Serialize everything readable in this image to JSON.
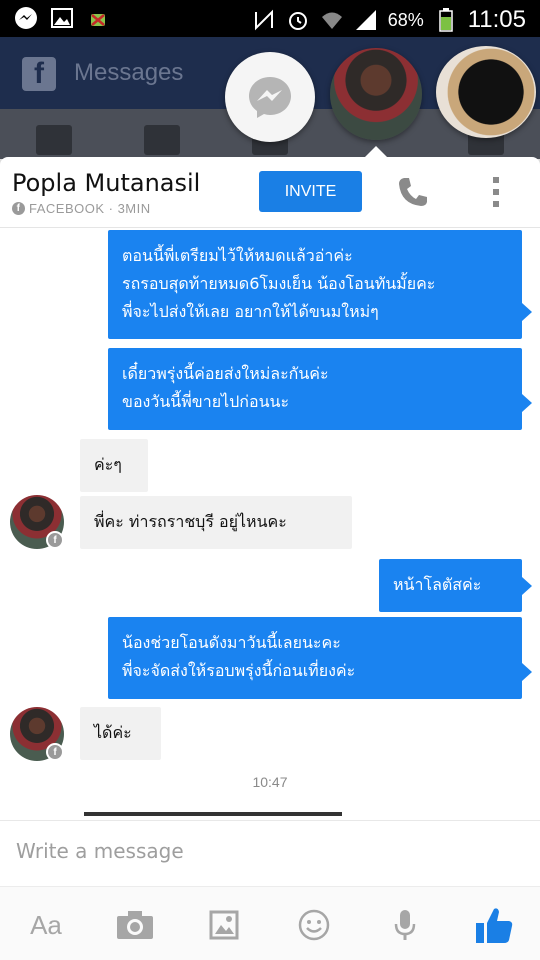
{
  "status_bar": {
    "battery": "68%",
    "time": "11:05",
    "icons": [
      "messenger-icon",
      "image-icon",
      "android-debug-icon",
      "nfc-icon",
      "alarm-icon",
      "wifi-icon",
      "signal-icon",
      "battery-icon"
    ]
  },
  "background_app": {
    "title": "Messages",
    "logo": "f"
  },
  "chat": {
    "contact_name": "Popla Mutanasil",
    "contact_source": "FACEBOOK · 3MIN",
    "invite_label": "INVITE",
    "messages": [
      {
        "direction": "out",
        "text": "ตอนนี้พี่เตรียมไว้ให้หมดแล้วอ่าค่ะ\nรถรอบสุดท้ายหมด6โมงเย็น น้องโอนทันมั้ยคะ\nพี่จะไปส่งให้เลย อยากให้ได้ขนมใหม่ๆ"
      },
      {
        "direction": "out",
        "text": "เดี๋ยวพรุ่งนี้ค่อยส่งใหม่ละกันค่ะ\nของวันนี้พี่ขายไปก่อนนะ"
      },
      {
        "direction": "in",
        "text": "ค่ะๆ"
      },
      {
        "direction": "in",
        "text": "พี่คะ ท่ารถราชบุรี อยู่ไหนคะ"
      },
      {
        "direction": "out",
        "text": "หน้าโลตัสค่ะ"
      },
      {
        "direction": "out",
        "text": "น้องช่วยโอนดังมาวันนี้เลยนะคะ\nพี่จะจัดส่งให้รอบพรุ่งนี้ก่อนเที่ยงค่ะ"
      },
      {
        "direction": "in",
        "text": "ได้ค่ะ"
      }
    ],
    "timestamp": "10:47",
    "composer_placeholder": "Write a message",
    "toolbar": {
      "text_format_label": "Aa",
      "icons": [
        "camera-icon",
        "gallery-icon",
        "emoji-icon",
        "microphone-icon",
        "thumbs-up-icon"
      ]
    }
  },
  "colors": {
    "accent": "#1a7fe5",
    "outgoing_bubble": "#1a83f0",
    "incoming_bubble": "#f1f1f1"
  }
}
